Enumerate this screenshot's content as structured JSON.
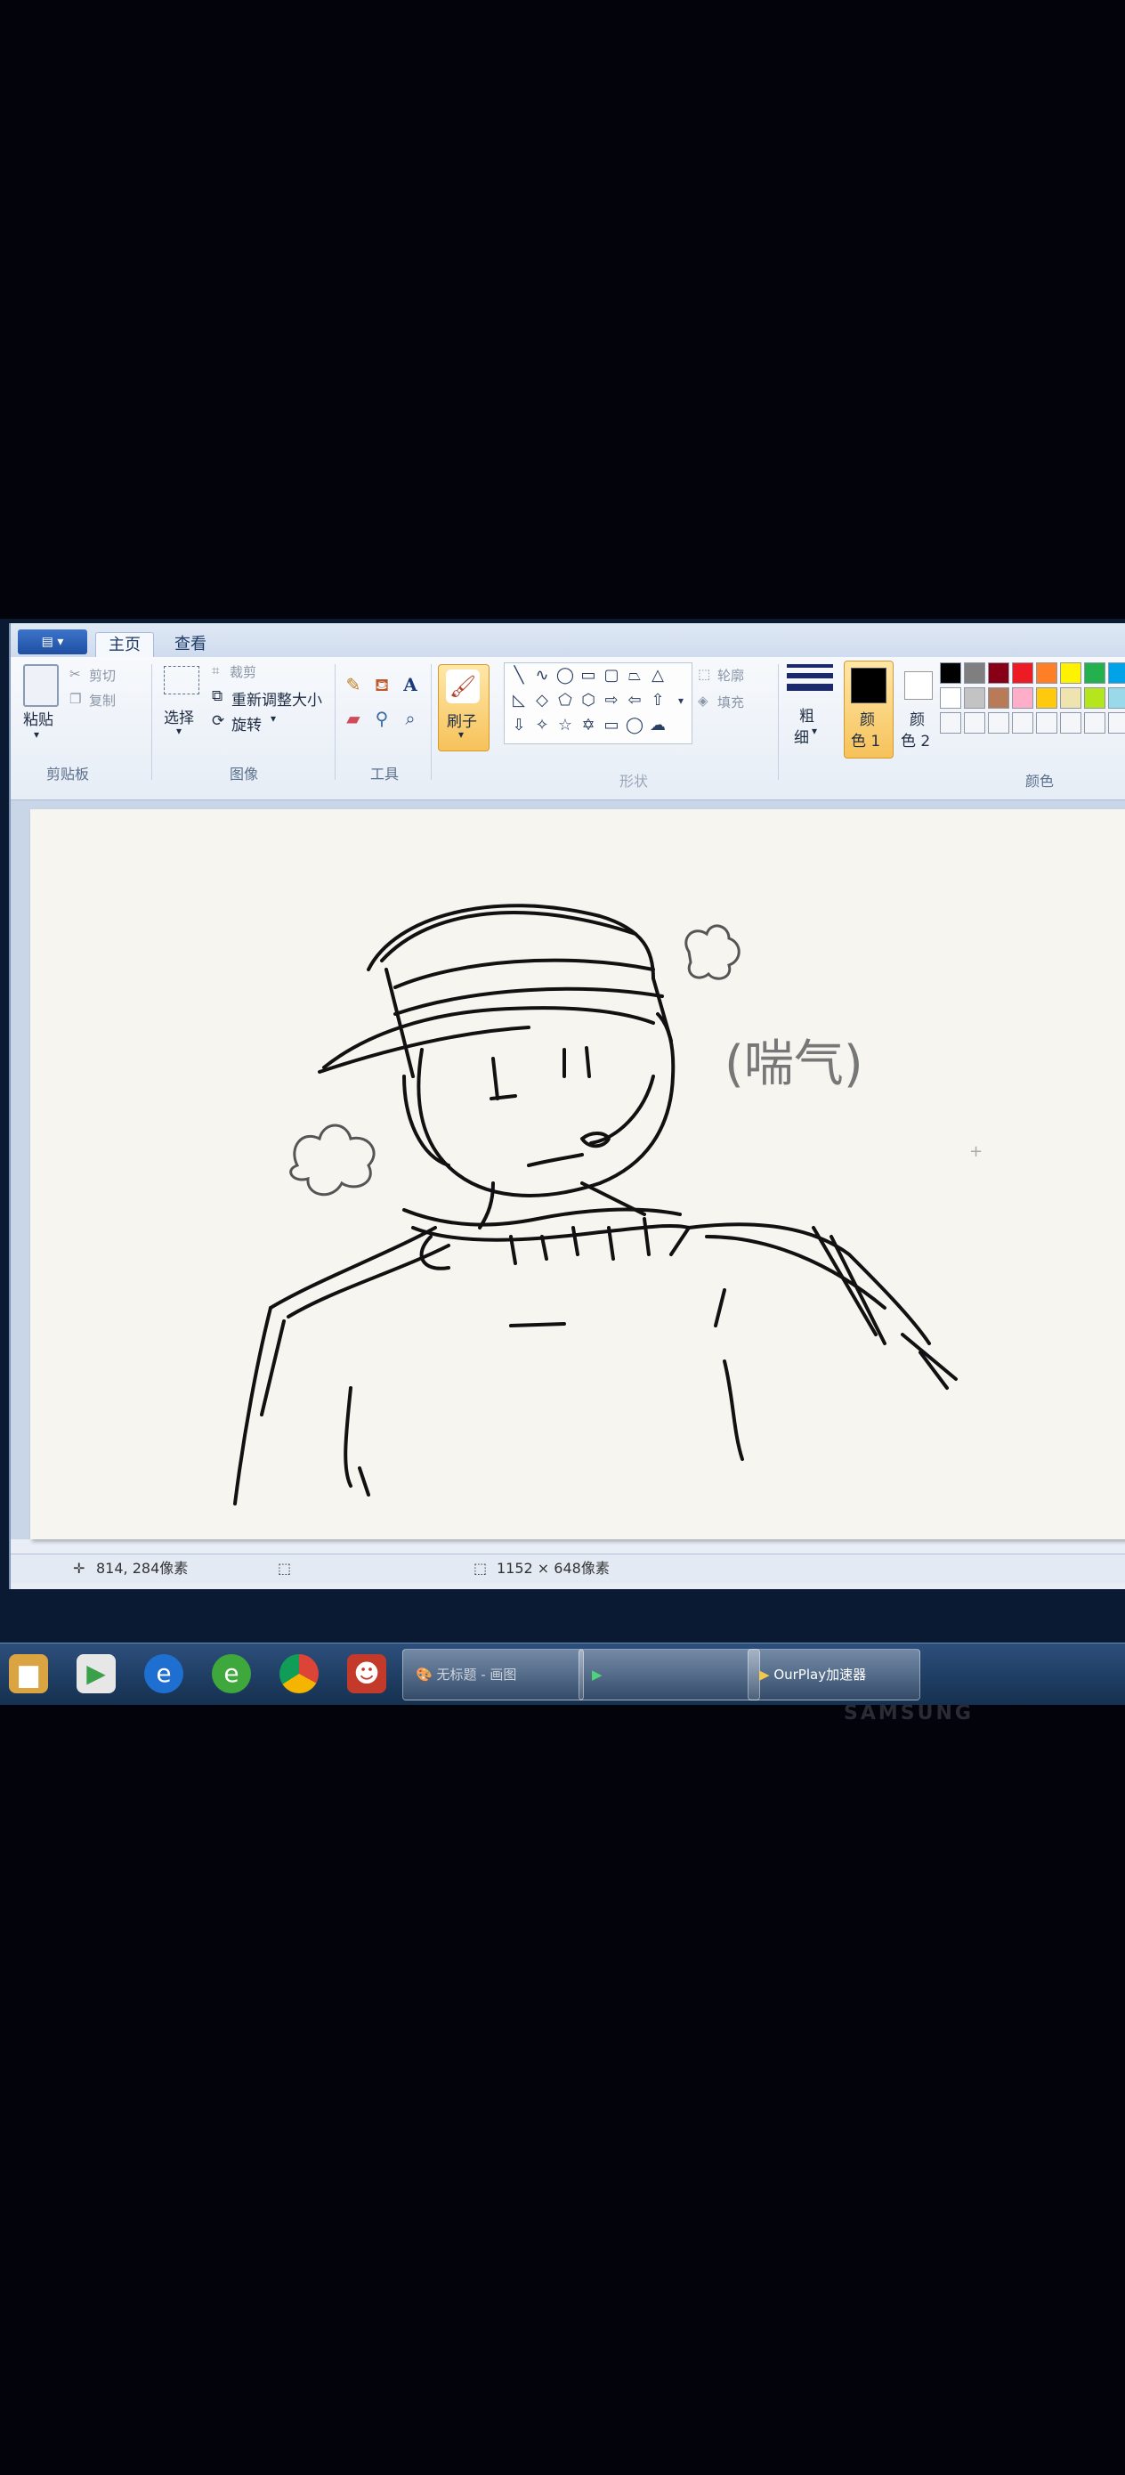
{
  "ribbon": {
    "tabs": [
      {
        "label": "主页"
      },
      {
        "label": "查看"
      }
    ],
    "clipboard": {
      "paste": "粘贴",
      "cut": "剪切",
      "copy": "复制",
      "group": "剪贴板"
    },
    "image": {
      "select": "选择",
      "crop": "裁剪",
      "resize": "重新调整大小",
      "rotate": "旋转",
      "group": "图像"
    },
    "tools": {
      "group": "工具"
    },
    "brushes": {
      "label": "刷子"
    },
    "shapes": {
      "outline": "轮廓",
      "fill": "填充",
      "group": "形状"
    },
    "size": {
      "label1": "粗",
      "label2": "细"
    },
    "color1": {
      "label1": "颜",
      "label2": "色 1"
    },
    "color2": {
      "label1": "颜",
      "label2": "色 2"
    },
    "colors": {
      "group": "颜色"
    },
    "palette_row1": [
      "#000000",
      "#7f7f7f",
      "#880015",
      "#ed1c24",
      "#ff7f27",
      "#fff200",
      "#22b14c",
      "#00a2e8"
    ],
    "palette_row2": [
      "#ffffff",
      "#c3c3c3",
      "#b97a57",
      "#ffaec9",
      "#ffc90e",
      "#efe4b0",
      "#b5e61d",
      "#99d9ea"
    ],
    "selected_color1": "#000000",
    "selected_color2": "#ffffff"
  },
  "canvas": {
    "annotation": "(喘气)"
  },
  "status": {
    "cursor_position": "814, 284像素",
    "image_size": "1152 × 648像素"
  },
  "taskbar": {
    "apps": [
      {
        "icon": "folder-icon"
      },
      {
        "icon": "media-player-icon"
      },
      {
        "icon": "edge-icon"
      },
      {
        "icon": "ie-icon"
      },
      {
        "icon": "chrome-icon"
      },
      {
        "icon": "game-character-icon"
      }
    ],
    "paint_window": "无标题 - 画图",
    "ourplay_label": "OurPlay加速器"
  },
  "bezel": {
    "brand": "SAMSUNG"
  }
}
